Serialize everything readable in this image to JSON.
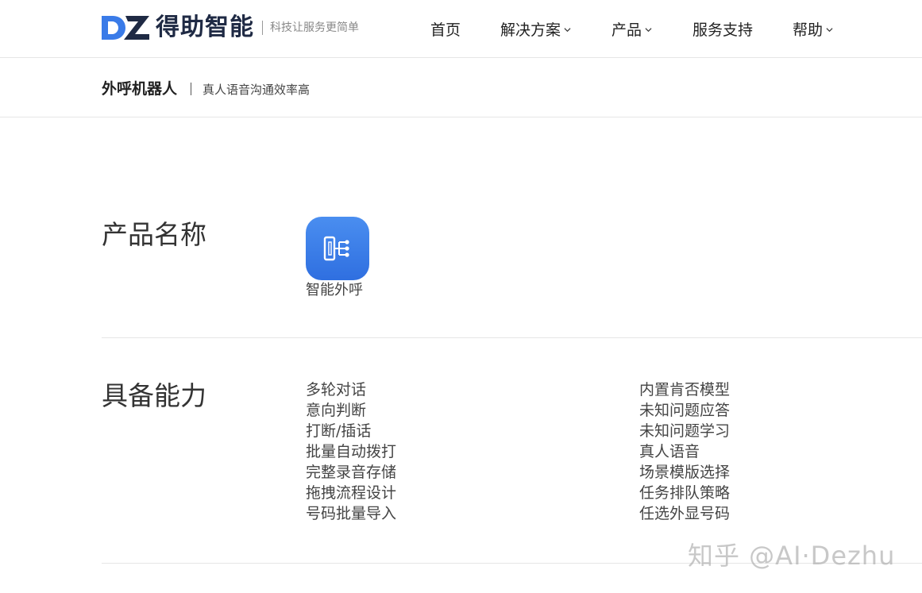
{
  "brand": {
    "name": "得助智能",
    "slogan": "科技让服务更简单",
    "primary_color": "#2f6fe0",
    "dark_color": "#1f2a44"
  },
  "nav": {
    "items": [
      {
        "label": "首页",
        "has_dropdown": false
      },
      {
        "label": "解决方案",
        "has_dropdown": true
      },
      {
        "label": "产品",
        "has_dropdown": true
      },
      {
        "label": "服务支持",
        "has_dropdown": false
      },
      {
        "label": "帮助",
        "has_dropdown": true
      }
    ]
  },
  "subheader": {
    "title": "外呼机器人",
    "description": "真人语音沟通效率高"
  },
  "product": {
    "section_label": "产品名称",
    "icon": "outbound-call-icon",
    "name": "智能外呼"
  },
  "capabilities": {
    "section_label": "具备能力",
    "left": [
      "多轮对话",
      "意向判断",
      "打断/插话",
      "批量自动拨打",
      "完整录音存储",
      "拖拽流程设计",
      "号码批量导入"
    ],
    "right": [
      "内置肯否模型",
      "未知问题应答",
      "未知问题学习",
      "真人语音",
      "场景模版选择",
      "任务排队策略",
      "任选外显号码"
    ]
  },
  "watermark": "知乎 @AI·Dezhu"
}
